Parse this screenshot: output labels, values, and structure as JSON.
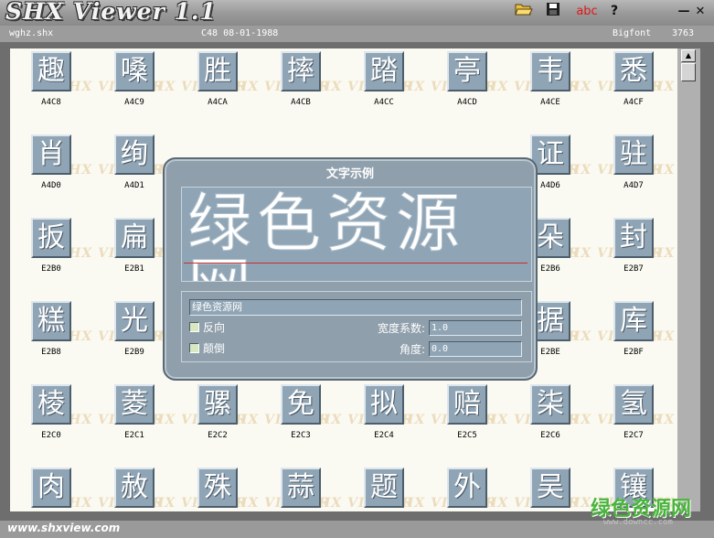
{
  "app": {
    "title": "SHX Viewer 1.1"
  },
  "toolbar": {
    "open_icon": "folder-open-icon",
    "save_icon": "floppy-save-icon",
    "font_sample_label": "abc",
    "help_label": "?"
  },
  "window_controls": {
    "minimize_label": "—",
    "close_label": "✕"
  },
  "info": {
    "filename": "wghz.shx",
    "header": "C48 08-01-1988",
    "font_type": "Bigfont",
    "count": "3763"
  },
  "watermark_text": "SHX VIEWER",
  "glyphs": [
    {
      "char": "趣",
      "code": "A4C8"
    },
    {
      "char": "嗓",
      "code": "A4C9"
    },
    {
      "char": "胜",
      "code": "A4CA"
    },
    {
      "char": "摔",
      "code": "A4CB"
    },
    {
      "char": "踏",
      "code": "A4CC"
    },
    {
      "char": "亭",
      "code": "A4CD"
    },
    {
      "char": "韦",
      "code": "A4CE"
    },
    {
      "char": "悉",
      "code": "A4CF"
    },
    {
      "char": "肖",
      "code": "A4D0"
    },
    {
      "char": "绚",
      "code": "A4D1"
    },
    {
      "char": "",
      "code": ""
    },
    {
      "char": "",
      "code": ""
    },
    {
      "char": "",
      "code": ""
    },
    {
      "char": "",
      "code": ""
    },
    {
      "char": "证",
      "code": "A4D6"
    },
    {
      "char": "驻",
      "code": "A4D7"
    },
    {
      "char": "扳",
      "code": "E2B0"
    },
    {
      "char": "扁",
      "code": "E2B1"
    },
    {
      "char": "",
      "code": ""
    },
    {
      "char": "",
      "code": ""
    },
    {
      "char": "",
      "code": ""
    },
    {
      "char": "",
      "code": ""
    },
    {
      "char": "朵",
      "code": "E2B6"
    },
    {
      "char": "封",
      "code": "E2B7"
    },
    {
      "char": "糕",
      "code": "E2B8"
    },
    {
      "char": "光",
      "code": "E2B9"
    },
    {
      "char": "",
      "code": ""
    },
    {
      "char": "",
      "code": ""
    },
    {
      "char": "",
      "code": ""
    },
    {
      "char": "",
      "code": ""
    },
    {
      "char": "据",
      "code": "E2BE"
    },
    {
      "char": "库",
      "code": "E2BF"
    },
    {
      "char": "棱",
      "code": "E2C0"
    },
    {
      "char": "菱",
      "code": "E2C1"
    },
    {
      "char": "骡",
      "code": "E2C2"
    },
    {
      "char": "免",
      "code": "E2C3"
    },
    {
      "char": "拟",
      "code": "E2C4"
    },
    {
      "char": "赔",
      "code": "E2C5"
    },
    {
      "char": "柒",
      "code": "E2C6"
    },
    {
      "char": "氢",
      "code": "E2C7"
    },
    {
      "char": "肉",
      "code": ""
    },
    {
      "char": "赦",
      "code": ""
    },
    {
      "char": "殊",
      "code": ""
    },
    {
      "char": "蒜",
      "code": ""
    },
    {
      "char": "题",
      "code": ""
    },
    {
      "char": "外",
      "code": ""
    },
    {
      "char": "吴",
      "code": ""
    },
    {
      "char": "镶",
      "code": ""
    }
  ],
  "dialog": {
    "title": "文字示例",
    "preview_text": "绿色资源网",
    "sample_input": "绿色资源网",
    "reverse_label": "反向",
    "invert_label": "颠倒",
    "width_factor_label": "宽度系数:",
    "width_factor_value": "1.0",
    "angle_label": "角度:",
    "angle_value": "0.0"
  },
  "footer": {
    "url": "www.shxview.com"
  },
  "site_watermark": {
    "title": "绿色资源网",
    "sub": "www.downcc.com"
  },
  "colors": {
    "glyph_tile": "#8fa4b4",
    "grid_background": "#fafaf2",
    "chrome": "#9c9c9c",
    "dialog": "#8f9fab",
    "preview_underline": "#c83030"
  }
}
